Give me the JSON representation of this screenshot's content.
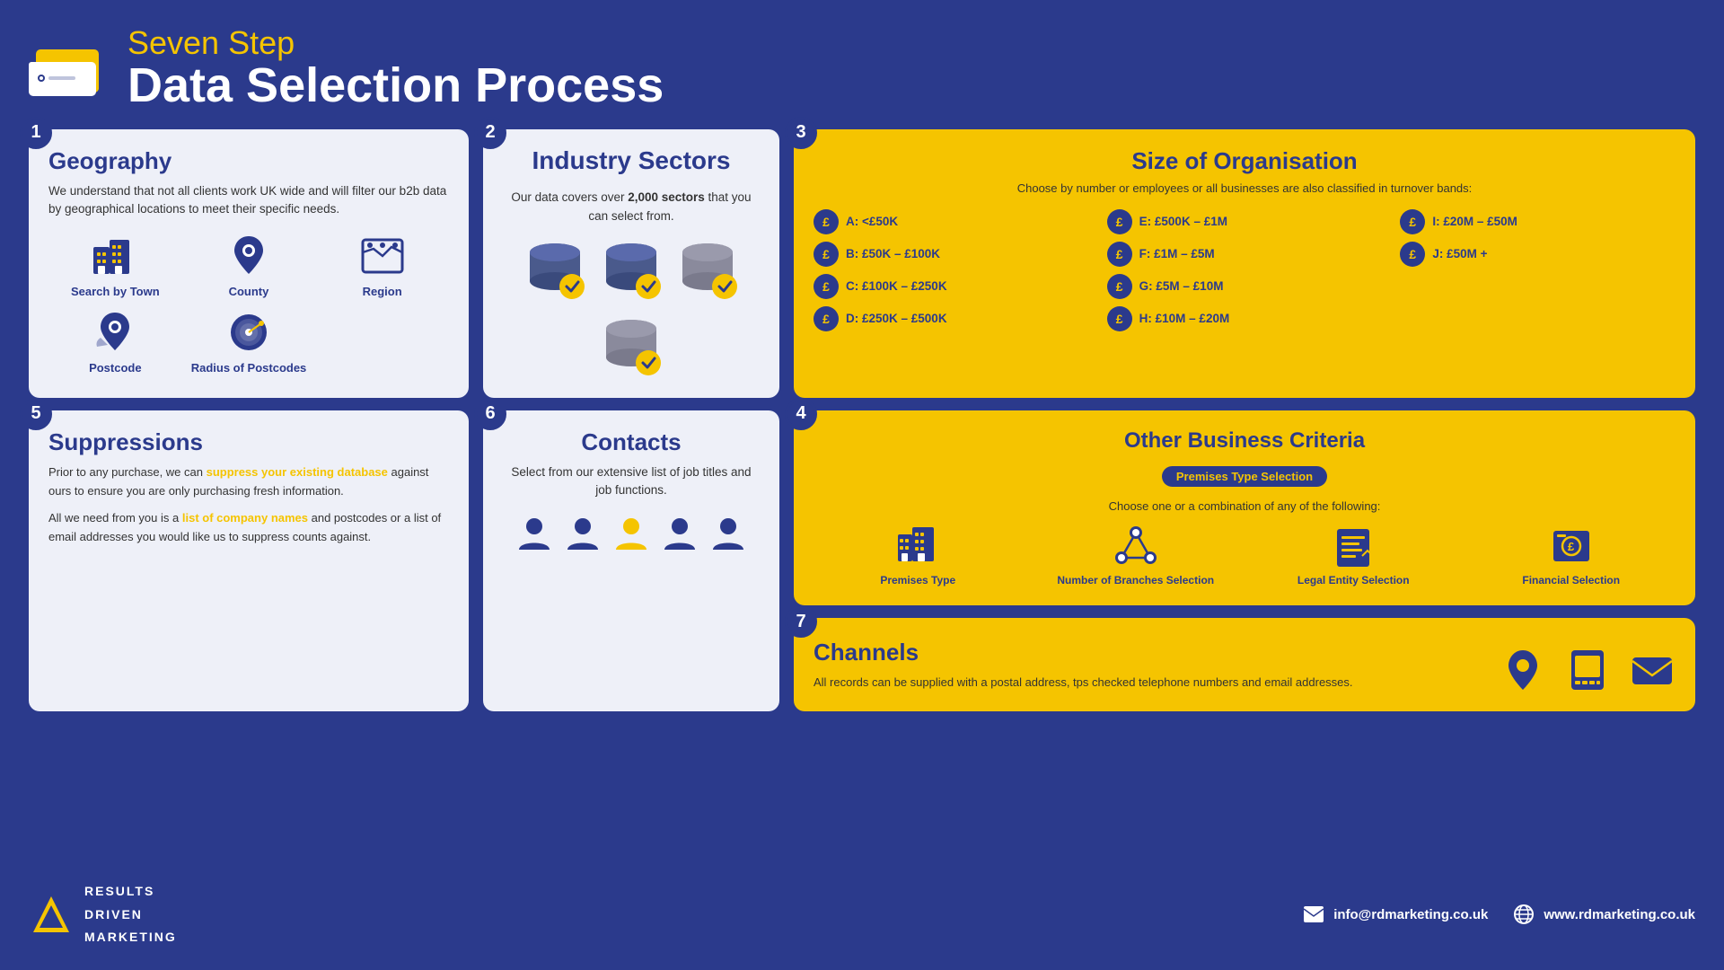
{
  "header": {
    "subtitle": "Seven Step",
    "title": "Data Selection Process"
  },
  "steps": {
    "geography": {
      "step": "1",
      "title": "Geography",
      "description": "We understand that not all clients work UK wide and will filter our b2b data by geographical locations to meet their specific needs.",
      "icons": [
        {
          "label": "Search by Town",
          "type": "building"
        },
        {
          "label": "County",
          "type": "pin"
        },
        {
          "label": "Region",
          "type": "region"
        },
        {
          "label": "Postcode",
          "type": "postcode"
        },
        {
          "label": "Radius of Postcodes",
          "type": "radius"
        }
      ]
    },
    "industry": {
      "step": "2",
      "title": "Industry Sectors",
      "description": "Our data covers over 2,000 sectors that you can select from.",
      "highlight": "2,000"
    },
    "size": {
      "step": "3",
      "title": "Size of Organisation",
      "subtitle": "Choose by number or employees or all businesses are also classified in turnover bands:",
      "bands": [
        {
          "label": "A: <£50K"
        },
        {
          "label": "E: £500K – £1M"
        },
        {
          "label": "I: £20M – £50M"
        },
        {
          "label": "B: £50K – £100K"
        },
        {
          "label": "F: £1M – £5M"
        },
        {
          "label": "J: £50M +"
        },
        {
          "label": "C: £100K – £250K"
        },
        {
          "label": "G: £5M – £10M"
        },
        {
          "label": ""
        },
        {
          "label": "D: £250K – £500K"
        },
        {
          "label": "H: £10M – £20M"
        },
        {
          "label": ""
        }
      ]
    },
    "suppressions": {
      "step": "5",
      "title": "Suppressions",
      "para1_start": "Prior to any purchase, we can ",
      "para1_highlight": "suppress your existing database",
      "para1_end": " against ours to ensure you are only purchasing fresh information.",
      "para2_start": "All we need from you is a ",
      "para2_highlight": "list of company names",
      "para2_end": " and postcodes or a list of email addresses you would like us to suppress counts against."
    },
    "contacts": {
      "step": "6",
      "title": "Contacts",
      "description": "Select from our extensive list of job titles and job functions."
    },
    "obc": {
      "step": "4",
      "title": "Other Business Criteria",
      "badge": "Premises Type Selection",
      "subtitle": "Choose one or a combination of any of the following:",
      "icons": [
        {
          "label": "Premises Type",
          "type": "building"
        },
        {
          "label": "Number of Branches Selection",
          "type": "branches"
        },
        {
          "label": "Legal Entity Selection",
          "type": "legal"
        },
        {
          "label": "Financial Selection",
          "type": "financial"
        }
      ]
    },
    "channels": {
      "step": "7",
      "title": "Channels",
      "description": "All records can be supplied with a postal address, tps checked telephone numbers and email addresses."
    }
  },
  "footer": {
    "logo_lines": [
      "RESULTS",
      "DRIVEN",
      "MARKETING"
    ],
    "email": "info@rdmarketing.co.uk",
    "website": "www.rdmarketing.co.uk"
  }
}
